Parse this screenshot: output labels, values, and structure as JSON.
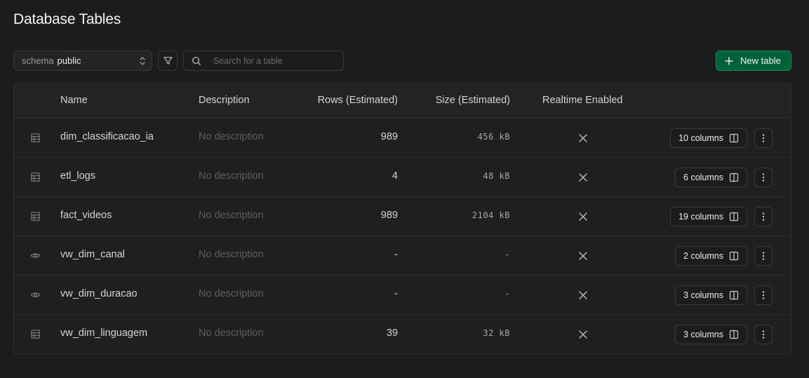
{
  "page": {
    "title": "Database Tables"
  },
  "toolbar": {
    "schema_label": "schema",
    "schema_value": "public",
    "search_placeholder": "Search for a table",
    "new_table_label": "New table"
  },
  "table": {
    "headers": {
      "name": "Name",
      "description": "Description",
      "rows": "Rows (Estimated)",
      "size": "Size (Estimated)",
      "realtime": "Realtime Enabled"
    },
    "rows": [
      {
        "type": "table",
        "icon": "table-icon",
        "name": "dim_classificacao_ia",
        "description": "No description",
        "rows": "989",
        "size": "456 kB",
        "realtime": false,
        "columns": "10 columns"
      },
      {
        "type": "table",
        "icon": "table-icon",
        "name": "etl_logs",
        "description": "No description",
        "rows": "4",
        "size": "48 kB",
        "realtime": false,
        "columns": "6 columns"
      },
      {
        "type": "table",
        "icon": "table-icon",
        "name": "fact_videos",
        "description": "No description",
        "rows": "989",
        "size": "2104 kB",
        "realtime": false,
        "columns": "19 columns"
      },
      {
        "type": "view",
        "icon": "eye-icon",
        "name": "vw_dim_canal",
        "description": "No description",
        "rows": "-",
        "size": "-",
        "realtime": false,
        "columns": "2 columns"
      },
      {
        "type": "view",
        "icon": "eye-icon",
        "name": "vw_dim_duracao",
        "description": "No description",
        "rows": "-",
        "size": "-",
        "realtime": false,
        "columns": "3 columns"
      },
      {
        "type": "table",
        "icon": "table-icon",
        "name": "vw_dim_linguagem",
        "description": "No description",
        "rows": "39",
        "size": "32 kB",
        "realtime": false,
        "columns": "3 columns"
      }
    ]
  },
  "colors": {
    "background": "#1c1c1c",
    "accent": "#006239",
    "accent_border": "#1f8a5a",
    "muted_text": "#5e5e5e"
  }
}
